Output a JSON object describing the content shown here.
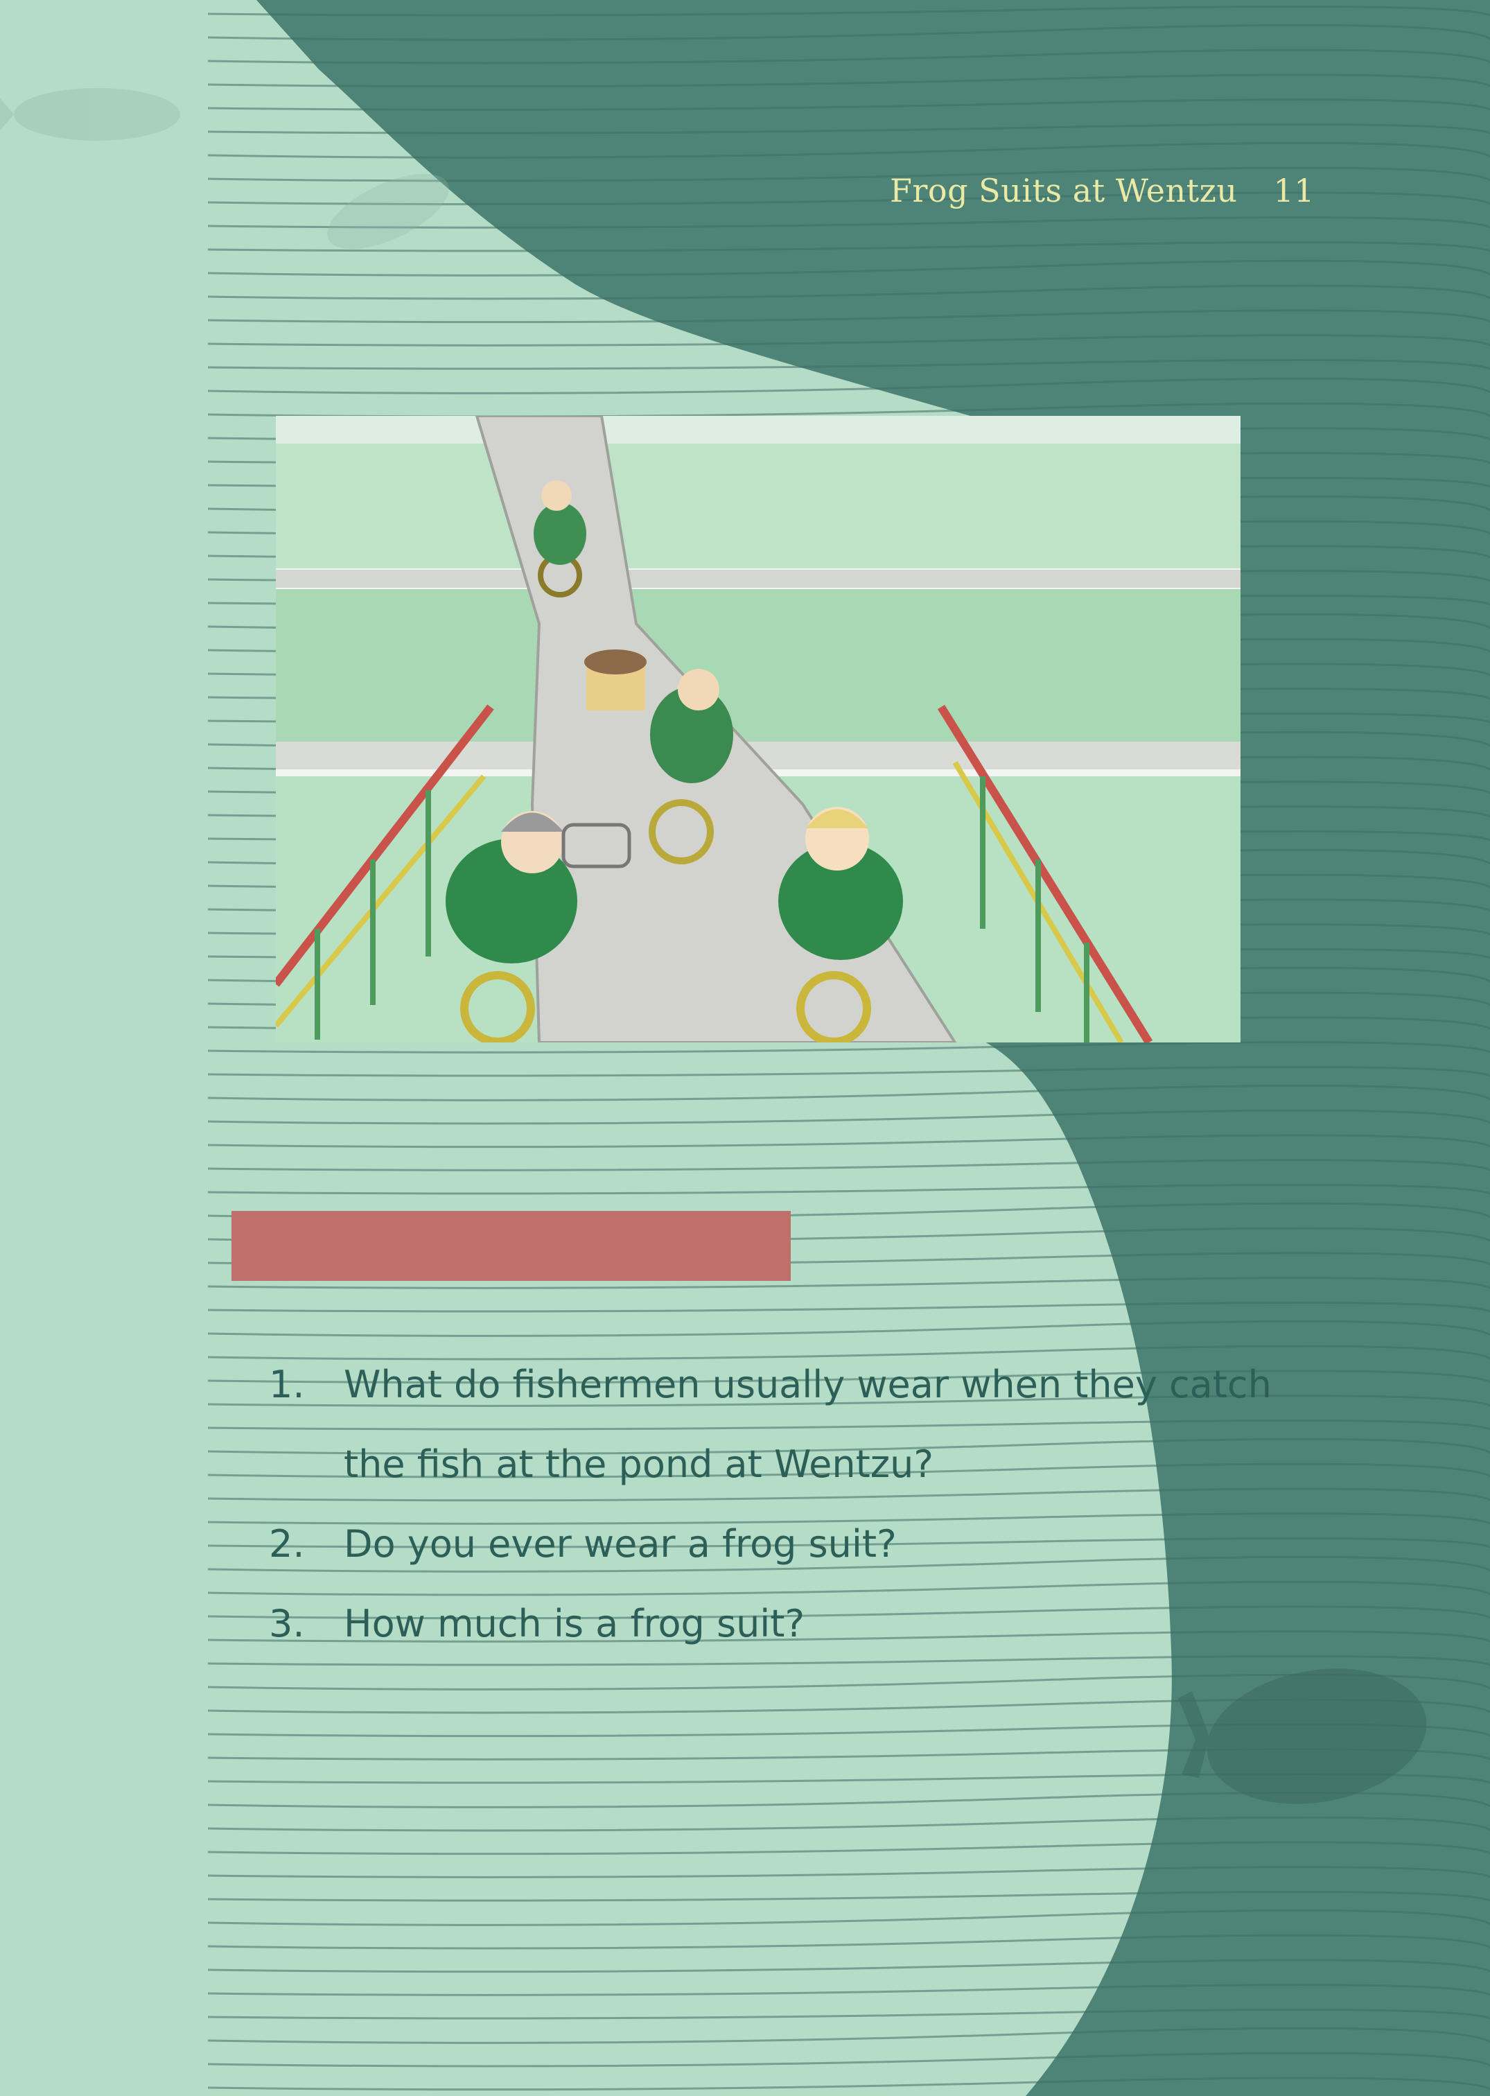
{
  "header": {
    "title": "Frog Suits at Wentzu",
    "page_number": "11"
  },
  "illustration": {
    "subject": "fishermen in green frog suits riding motorbikes across a bridge between fish ponds"
  },
  "colors": {
    "light_bg": "#b5dcc7",
    "dark_bg": "#4e8377",
    "header_text": "#eae9a6",
    "accent_bar": "#c0706a",
    "question_text": "#2c5f58"
  },
  "questions": [
    {
      "number": "1.",
      "text": "What do fishermen usually wear when they catch the fish at the pond at Wentzu?"
    },
    {
      "number": "2.",
      "text": "Do you ever wear a frog suit?"
    },
    {
      "number": "3.",
      "text": "How much is a frog suit?"
    }
  ]
}
